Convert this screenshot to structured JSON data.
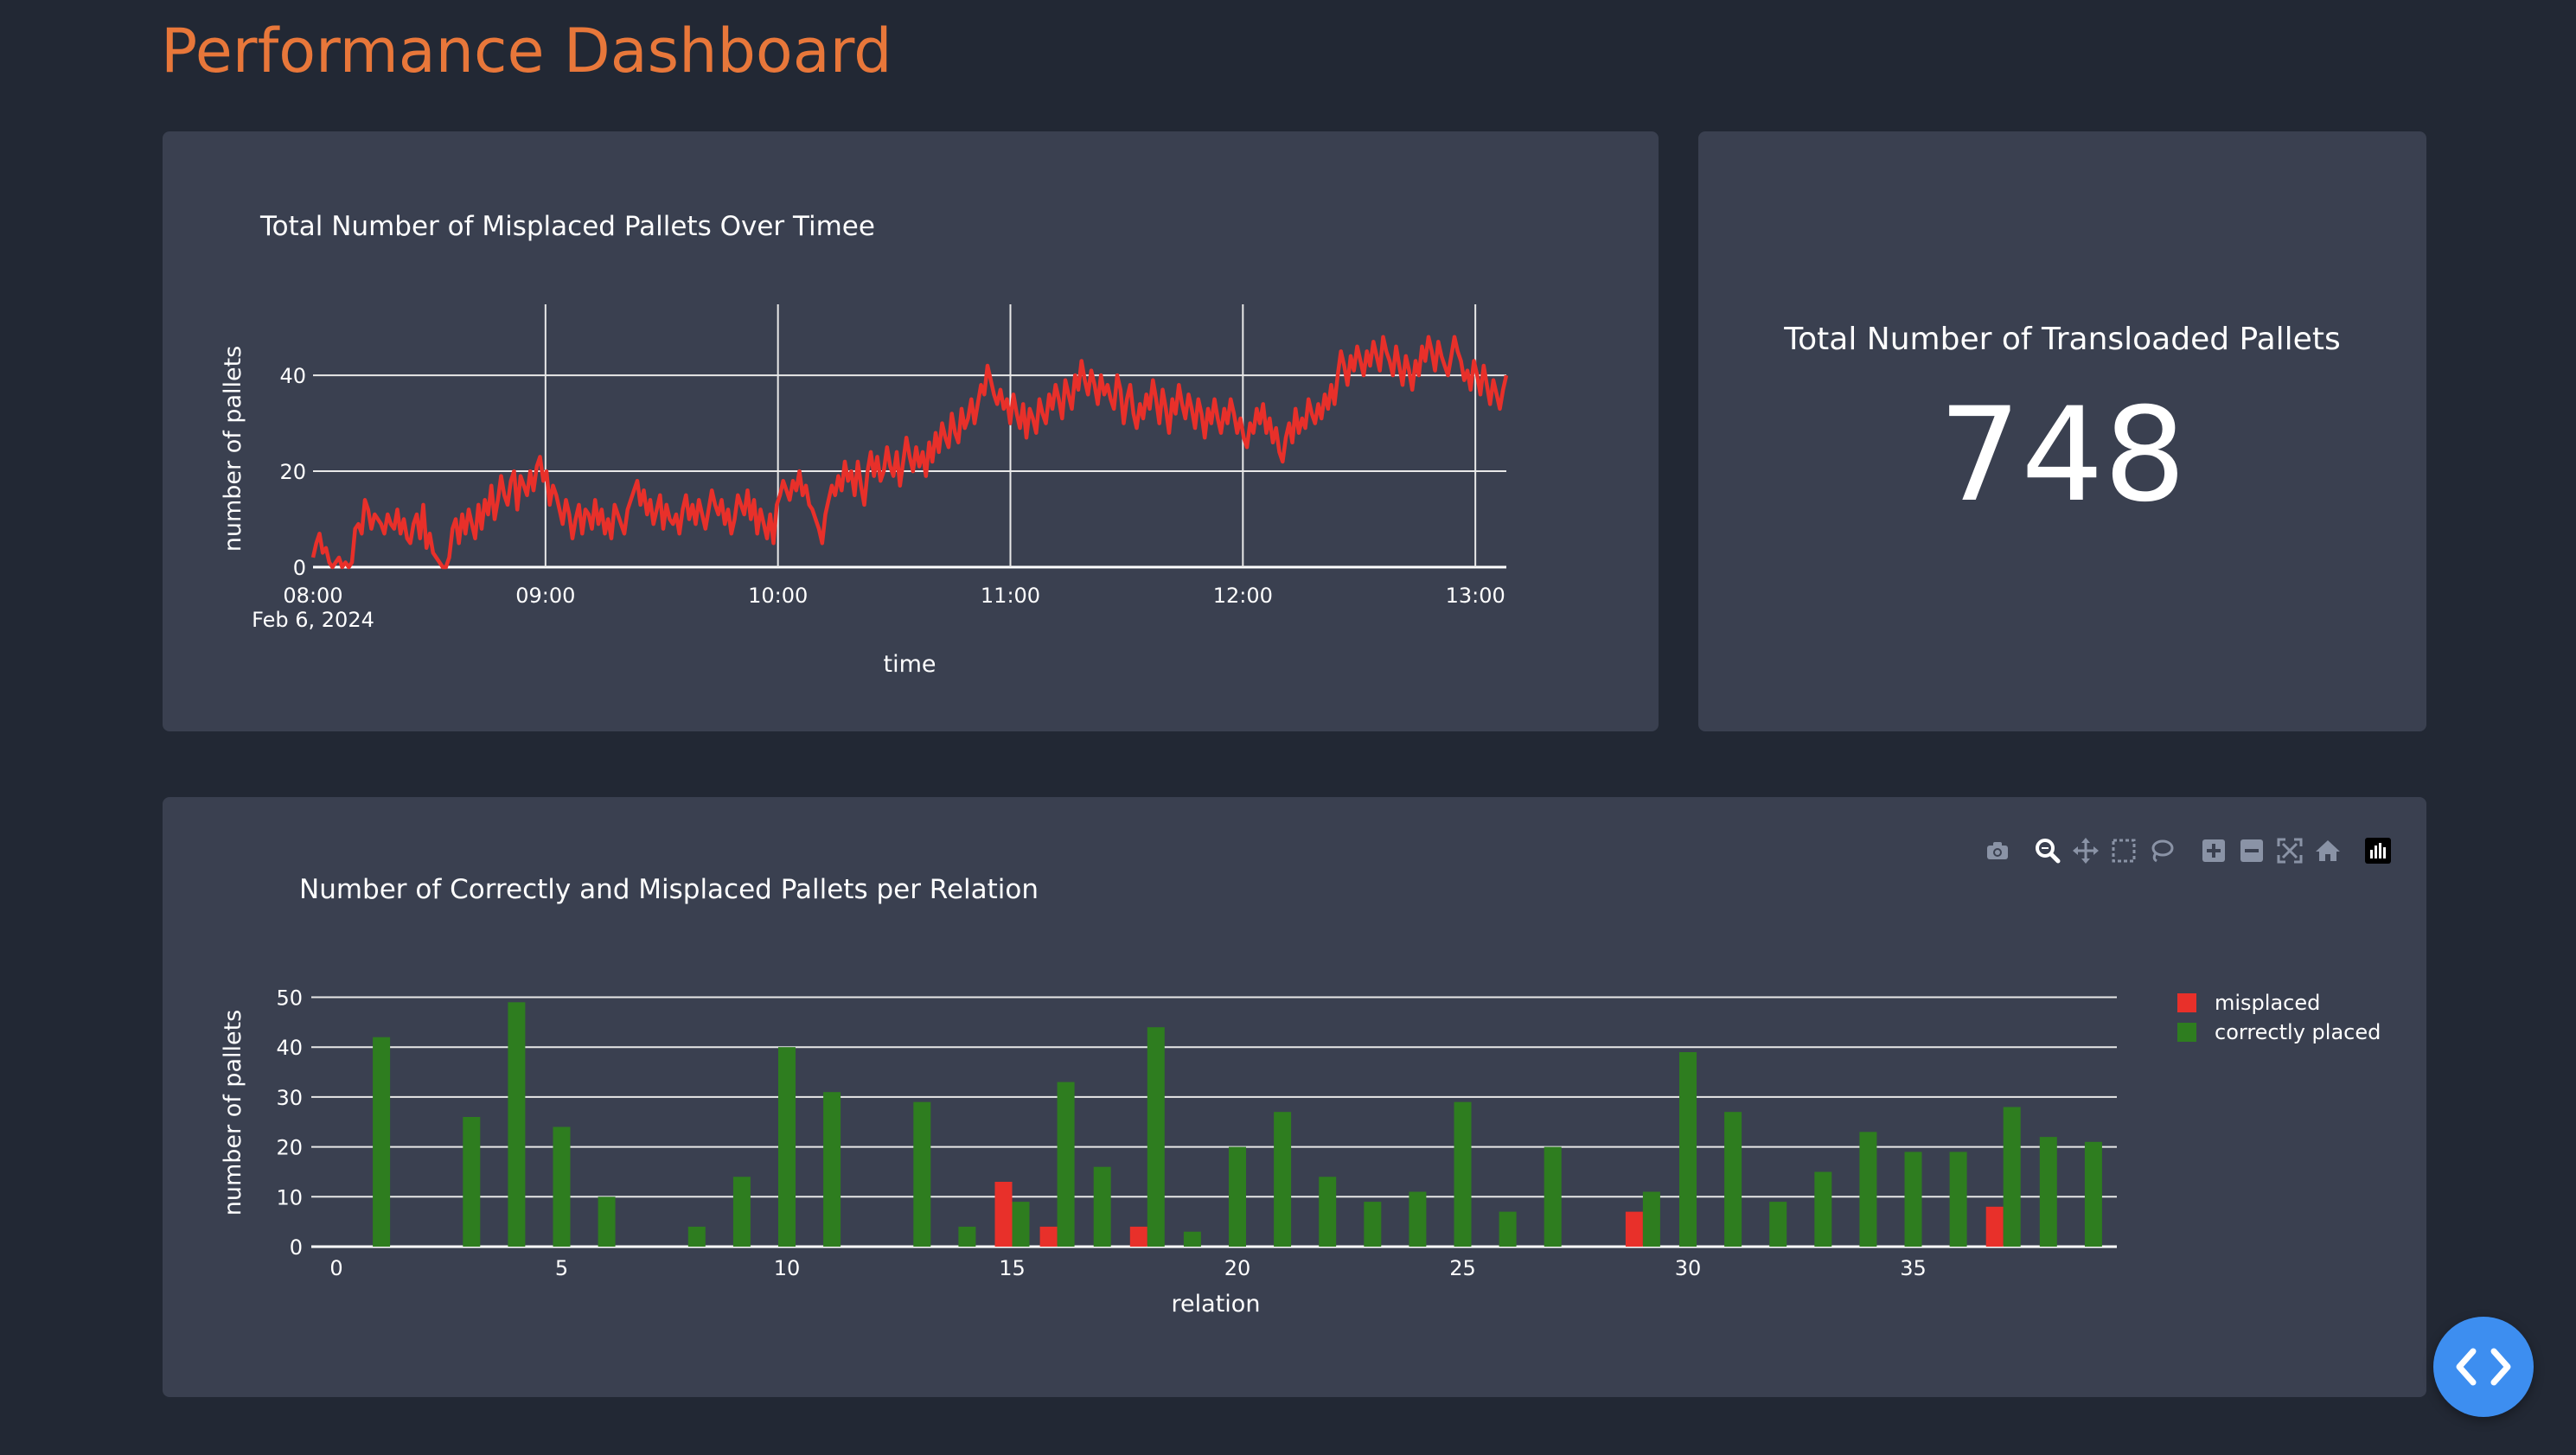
{
  "page": {
    "title": "Performance Dashboard"
  },
  "colors": {
    "accent": "#e8773a",
    "background": "#222834",
    "card": "#3a4050",
    "misplaced": "#e8302a",
    "correct": "#2e7d1f",
    "fab": "#3d8ef0"
  },
  "kpi": {
    "title": "Total Number of Transloaded Pallets",
    "value": "748"
  },
  "modebar": {
    "icons": [
      "camera-icon",
      "zoom-icon",
      "pan-icon",
      "box-select-icon",
      "lasso-icon",
      "zoom-in-icon",
      "zoom-out-icon",
      "autoscale-icon",
      "reset-axes-icon",
      "plotly-logo-icon"
    ]
  },
  "chart_data": [
    {
      "type": "line",
      "title": "Total Number of Misplaced Pallets Over Timee",
      "xlabel": "time",
      "ylabel": "number of pallets",
      "x_start": "2024-02-06 08:00",
      "x_end": "2024-02-06 13:08",
      "x_ticks": [
        "08:00",
        "09:00",
        "10:00",
        "11:00",
        "12:00",
        "13:00"
      ],
      "x_tick_sublabel": "Feb 6, 2024",
      "y_ticks": [
        "0",
        "20",
        "40"
      ],
      "ylim": [
        0,
        53
      ],
      "grid": true,
      "series": [
        {
          "color": "#e8302a",
          "y": [
            2,
            5,
            7,
            3,
            4,
            1,
            0,
            1,
            2,
            0,
            1,
            0,
            1,
            8,
            9,
            7,
            14,
            12,
            8,
            11,
            10,
            9,
            7,
            11,
            9,
            8,
            12,
            7,
            10,
            6,
            5,
            9,
            11,
            6,
            13,
            4,
            7,
            3,
            2,
            1,
            0,
            0,
            2,
            8,
            10,
            5,
            11,
            7,
            12,
            9,
            6,
            13,
            8,
            14,
            11,
            17,
            10,
            14,
            19,
            15,
            13,
            18,
            20,
            12,
            19,
            17,
            15,
            20,
            16,
            21,
            23,
            18,
            20,
            13,
            17,
            15,
            12,
            9,
            14,
            11,
            6,
            10,
            13,
            7,
            12,
            11,
            8,
            14,
            9,
            12,
            7,
            10,
            6,
            13,
            11,
            9,
            7,
            12,
            14,
            16,
            18,
            13,
            16,
            11,
            14,
            9,
            12,
            15,
            8,
            13,
            10,
            9,
            11,
            7,
            12,
            15,
            10,
            13,
            9,
            14,
            11,
            8,
            12,
            16,
            13,
            11,
            14,
            9,
            12,
            7,
            10,
            15,
            13,
            11,
            16,
            10,
            14,
            7,
            12,
            9,
            6,
            11,
            5,
            13,
            15,
            18,
            16,
            14,
            18,
            16,
            20,
            15,
            17,
            13,
            12,
            10,
            8,
            5,
            11,
            14,
            17,
            15,
            19,
            16,
            22,
            18,
            20,
            15,
            22,
            17,
            13,
            20,
            24,
            19,
            23,
            18,
            20,
            25,
            21,
            19,
            24,
            17,
            22,
            27,
            23,
            20,
            25,
            21,
            24,
            19,
            26,
            22,
            28,
            24,
            30,
            27,
            25,
            32,
            28,
            26,
            33,
            29,
            31,
            35,
            30,
            34,
            38,
            36,
            42,
            39,
            36,
            34,
            37,
            33,
            35,
            30,
            36,
            32,
            29,
            34,
            27,
            33,
            31,
            28,
            35,
            32,
            30,
            36,
            33,
            38,
            35,
            31,
            39,
            36,
            33,
            40,
            37,
            43,
            39,
            36,
            41,
            38,
            34,
            40,
            36,
            38,
            35,
            33,
            40,
            37,
            30,
            35,
            38,
            32,
            29,
            34,
            31,
            36,
            33,
            39,
            35,
            30,
            37,
            33,
            28,
            35,
            32,
            38,
            34,
            31,
            36,
            33,
            29,
            35,
            32,
            27,
            33,
            30,
            35,
            31,
            28,
            33,
            30,
            35,
            32,
            28,
            31,
            27,
            25,
            30,
            28,
            33,
            30,
            34,
            28,
            31,
            26,
            29,
            24,
            22,
            27,
            30,
            26,
            33,
            28,
            31,
            29,
            35,
            32,
            30,
            34,
            31,
            36,
            33,
            38,
            34,
            40,
            45,
            42,
            38,
            44,
            41,
            46,
            43,
            40,
            45,
            42,
            47,
            44,
            41,
            48,
            45,
            43,
            40,
            46,
            42,
            38,
            44,
            41,
            37,
            43,
            40,
            46,
            43,
            48,
            45,
            41,
            47,
            44,
            42,
            40,
            44,
            48,
            45,
            43,
            39,
            41,
            37,
            43,
            40,
            36,
            42,
            38,
            34,
            39,
            36,
            33,
            37,
            40
          ]
        }
      ]
    },
    {
      "type": "bar",
      "title": "Number of Correctly and Misplaced Pallets per Relation",
      "xlabel": "relation",
      "ylabel": "number of pallets",
      "x_ticks": [
        "0",
        "5",
        "10",
        "15",
        "20",
        "25",
        "30",
        "35"
      ],
      "y_ticks": [
        "0",
        "10",
        "20",
        "30",
        "40",
        "50"
      ],
      "ylim": [
        0,
        52
      ],
      "grid": true,
      "legend_position": "top-right",
      "series": [
        {
          "name": "misplaced",
          "color": "#e8302a",
          "x": [
            15,
            16,
            18,
            29,
            37
          ],
          "values": [
            13,
            4,
            4,
            7,
            8
          ]
        },
        {
          "name": "correctly placed",
          "color": "#2e7d1f",
          "x": [
            1,
            3,
            4,
            5,
            6,
            8,
            9,
            10,
            11,
            13,
            14,
            15,
            16,
            17,
            18,
            19,
            20,
            21,
            22,
            23,
            24,
            25,
            26,
            27,
            29,
            30,
            31,
            32,
            33,
            34,
            35,
            36,
            37,
            38,
            39
          ],
          "values": [
            42,
            26,
            49,
            24,
            10,
            4,
            14,
            40,
            31,
            29,
            4,
            9,
            33,
            16,
            44,
            3,
            20,
            27,
            14,
            9,
            11,
            29,
            7,
            20,
            11,
            39,
            27,
            9,
            15,
            23,
            19,
            19,
            28,
            22,
            21
          ]
        }
      ]
    }
  ]
}
